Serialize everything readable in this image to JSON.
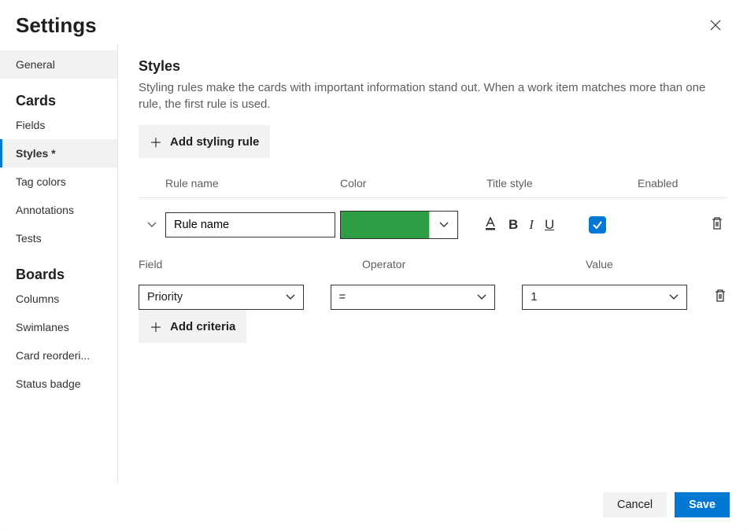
{
  "header": {
    "title": "Settings"
  },
  "sidebar": {
    "general": "General",
    "cards_cat": "Cards",
    "boards_cat": "Boards",
    "cards": [
      {
        "label": "Fields"
      },
      {
        "label": "Styles *"
      },
      {
        "label": "Tag colors"
      },
      {
        "label": "Annotations"
      },
      {
        "label": "Tests"
      }
    ],
    "boards": [
      {
        "label": "Columns"
      },
      {
        "label": "Swimlanes"
      },
      {
        "label": "Card reorderi..."
      },
      {
        "label": "Status badge"
      }
    ]
  },
  "main": {
    "section_title": "Styles",
    "desc": "Styling rules make the cards with important information stand out. When a work item matches more than one rule, the first rule is used.",
    "add_rule": "Add styling rule",
    "cols": {
      "name": "Rule name",
      "color": "Color",
      "title": "Title style",
      "enabled": "Enabled"
    },
    "rule": {
      "name_value": "Rule name",
      "color_hex": "#2e9e45",
      "bold_glyph": "B",
      "italic_glyph": "I",
      "under_glyph": "U",
      "enabled": true
    },
    "criteria": {
      "labels": {
        "field": "Field",
        "operator": "Operator",
        "value": "Value"
      },
      "row": {
        "field": "Priority",
        "operator": "=",
        "value": "1"
      },
      "add": "Add criteria"
    }
  },
  "footer": {
    "cancel": "Cancel",
    "save": "Save"
  }
}
